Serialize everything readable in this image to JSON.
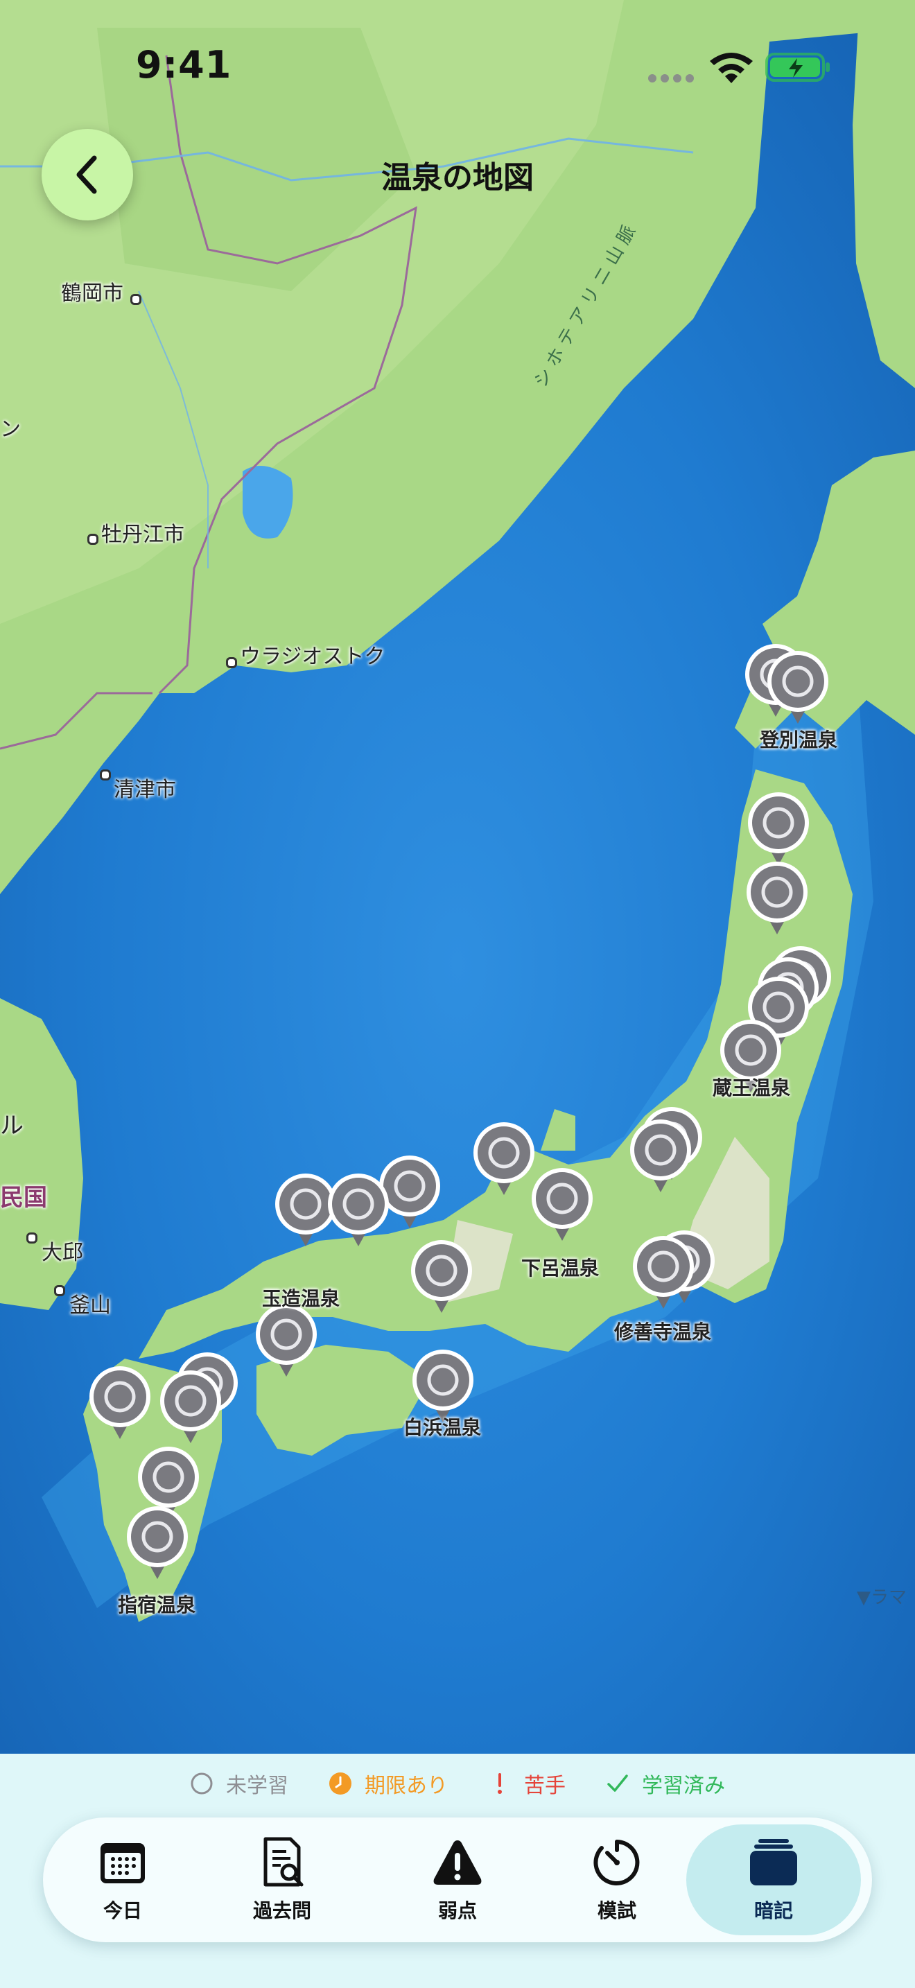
{
  "status_bar": {
    "time": "9:41"
  },
  "header": {
    "title": "温泉の地図"
  },
  "map": {
    "places": [
      {
        "name": "鶴岡市"
      },
      {
        "name": "牡丹江市"
      },
      {
        "name": "ウラジオストク"
      },
      {
        "name": "清津市"
      },
      {
        "name": "大邱"
      },
      {
        "name": "釜山"
      }
    ],
    "fragments": [
      "ン",
      "ル",
      "民国",
      "シホテアリニ山脈",
      "▼ラマ"
    ],
    "onsen_labels": [
      "登別温泉",
      "蔵王温泉",
      "下呂温泉",
      "修善寺温泉",
      "玉造温泉",
      "白浜温泉",
      "指宿温泉"
    ],
    "pin_status": "未学習"
  },
  "legend": [
    {
      "label": "未学習",
      "color": "#8e8e93"
    },
    {
      "label": "期限あり",
      "color": "#f39a25"
    },
    {
      "label": "苦手",
      "color": "#e5443a"
    },
    {
      "label": "学習済み",
      "color": "#31b85a"
    }
  ],
  "tabs": [
    {
      "label": "今日",
      "icon": "calendar-icon"
    },
    {
      "label": "過去問",
      "icon": "document-search-icon"
    },
    {
      "label": "弱点",
      "icon": "warning-icon"
    },
    {
      "label": "模試",
      "icon": "timer-icon"
    },
    {
      "label": "暗記",
      "icon": "card-stack-icon",
      "active": true
    }
  ]
}
